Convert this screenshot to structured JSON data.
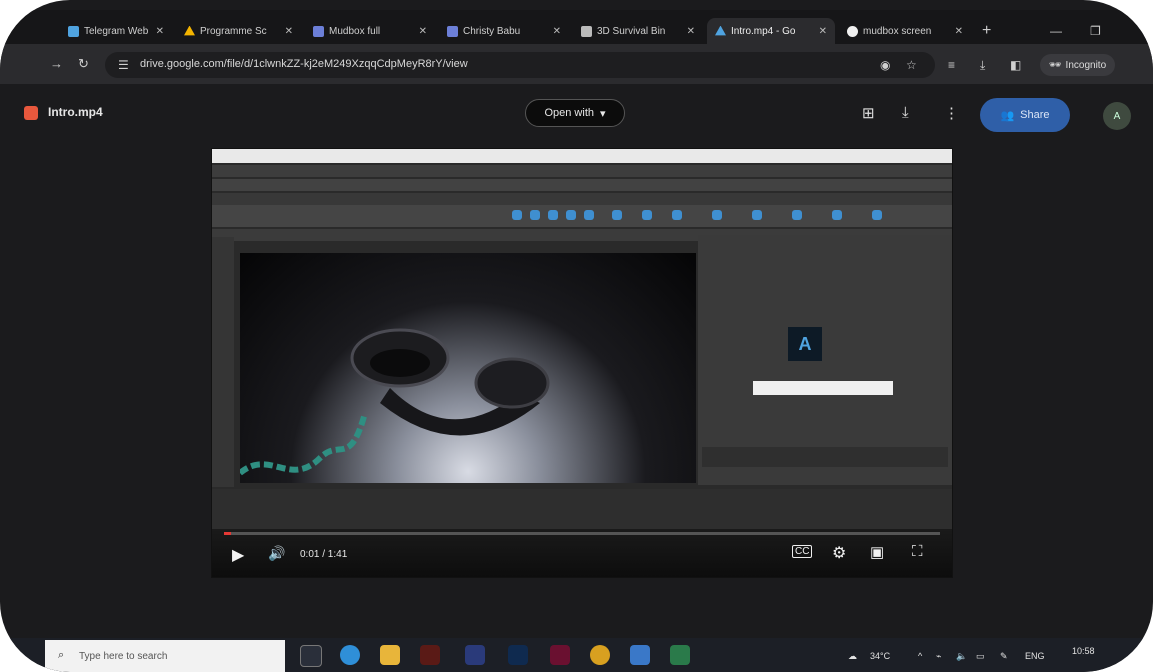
{
  "browser": {
    "tabs": [
      {
        "label": "Telegram Web",
        "icon": "telegram-icon",
        "color": "#4fa3e0",
        "active": false
      },
      {
        "label": "Programme Sc",
        "icon": "drive-icon",
        "color": "#f4b400",
        "active": false
      },
      {
        "label": "Mudbox full",
        "icon": "docs-icon",
        "color": "#6c7fd8",
        "active": false
      },
      {
        "label": "Christy Babu",
        "icon": "docs-icon",
        "color": "#6c7fd8",
        "active": false
      },
      {
        "label": "3D Survival Bin",
        "icon": "file-icon",
        "color": "#bbbbbb",
        "active": false
      },
      {
        "label": "Intro.mp4 - Go",
        "icon": "drive-icon",
        "color": "#4fa3e0",
        "active": true
      },
      {
        "label": "mudbox screen",
        "icon": "circle-icon",
        "color": "#f0f0f0",
        "active": false
      }
    ],
    "url": "drive.google.com/file/d/1clwnkZZ-kj2eM249XzqqCdpMeyR8rY/view",
    "incognito_label": "Incognito"
  },
  "drive": {
    "file_name": "Intro.mp4",
    "open_with_label": "Open with",
    "share_label": "Share",
    "avatar": "A"
  },
  "player": {
    "time": "0:01 / 1:41",
    "progress_fraction": 0.01
  },
  "taskbar": {
    "search_placeholder": "Type here to search",
    "weather": "34°C",
    "language": "ENG",
    "clock": "10:58"
  },
  "colors": {
    "accent": "#2f5fa8",
    "progress": "#e53935"
  }
}
